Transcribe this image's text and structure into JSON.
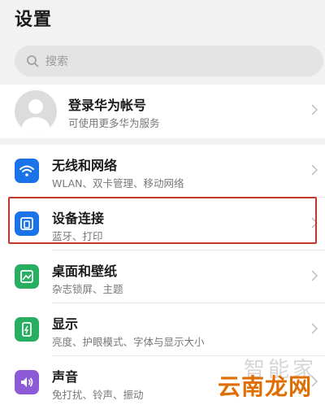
{
  "header": {
    "title": "设置"
  },
  "search": {
    "placeholder": "搜索"
  },
  "account": {
    "title": "登录华为帐号",
    "subtitle": "可使用更多华为服务"
  },
  "items": [
    {
      "title": "无线和网络",
      "subtitle": "WLAN、双卡管理、移动网络",
      "icon": "wifi-icon",
      "color": "#1a73e8"
    },
    {
      "title": "设备连接",
      "subtitle": "蓝牙、打印",
      "icon": "device-connect-icon",
      "color": "#1a73e8"
    },
    {
      "title": "桌面和壁纸",
      "subtitle": "杂志锁屏、主题",
      "icon": "wallpaper-icon",
      "color": "#27ae60"
    },
    {
      "title": "显示",
      "subtitle": "亮度、护眼模式、字体与显示大小",
      "icon": "display-icon",
      "color": "#27ae60"
    },
    {
      "title": "声音",
      "subtitle": "免打扰、铃声、振动",
      "icon": "sound-icon",
      "color": "#8e5bd8"
    }
  ],
  "watermark": {
    "line1": "智能家",
    "line2": "云南龙网"
  }
}
